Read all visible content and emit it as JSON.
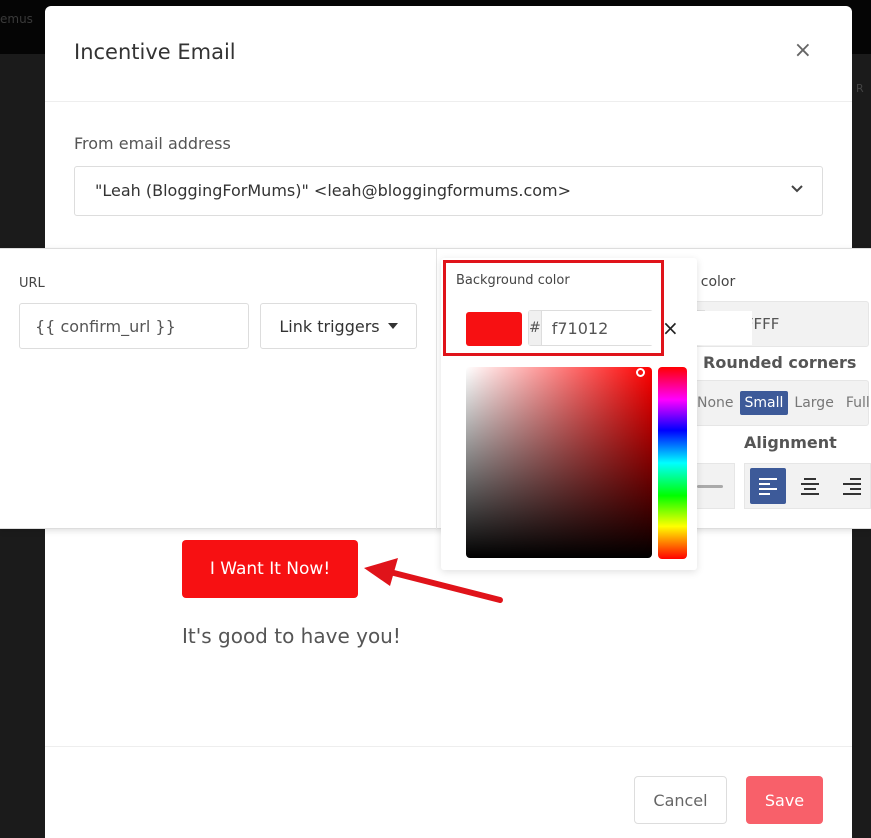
{
  "background": {
    "topbar_text": "emus",
    "side_text": "R"
  },
  "modal": {
    "title": "Incentive Email",
    "close_label": "×",
    "from": {
      "label": "From email address",
      "value": "\"Leah (BloggingForMums)\" <leah@bloggingformums.com>"
    },
    "preview": {
      "button_label": "I Want It Now!",
      "body_text": "It's good to have you!"
    },
    "footer": {
      "cancel_label": "Cancel",
      "save_label": "Save"
    }
  },
  "toolbar": {
    "url": {
      "label": "URL",
      "value": "{{ confirm_url }}"
    },
    "link_triggers_label": "Link triggers",
    "background_color": {
      "label": "Background color",
      "prefix": "#",
      "value": "f71012",
      "swatch": "#f71012",
      "clear_label": "×"
    },
    "text_color": {
      "label": "Text color",
      "value": "#FFFFFF"
    },
    "rounded_corners": {
      "label": "Rounded corners",
      "options": [
        "None",
        "Small",
        "Large",
        "Full"
      ],
      "selected": "Small"
    },
    "alignment": {
      "label": "Alignment",
      "options": [
        "left",
        "center",
        "right"
      ],
      "selected": "left"
    }
  },
  "colors": {
    "accent": "#3d5a99",
    "button_red": "#f71012",
    "save": "#f8606a",
    "annotation": "#e0131a"
  }
}
